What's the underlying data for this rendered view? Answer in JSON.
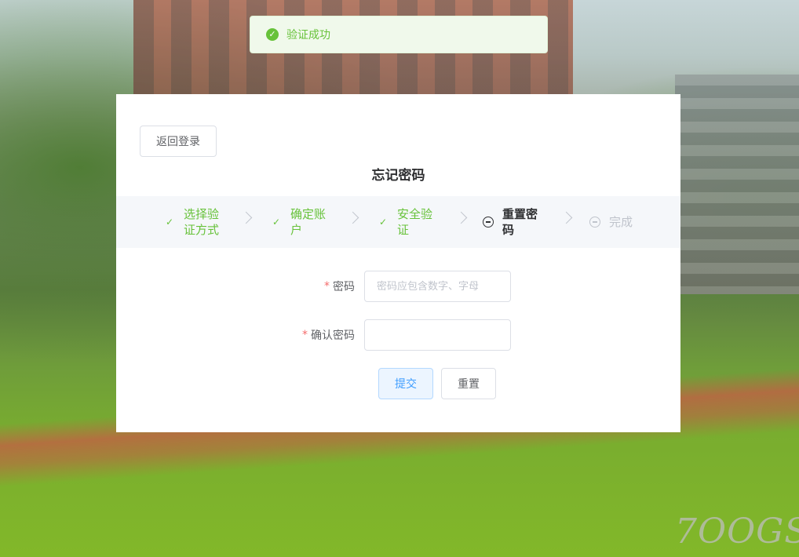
{
  "toast": {
    "message": "验证成功",
    "color": "#67c23a"
  },
  "card": {
    "back_button": "返回登录",
    "title": "忘记密码"
  },
  "steps": [
    {
      "label_line1": "选择验",
      "label_line2": "证方式",
      "status": "done"
    },
    {
      "label_line1": "确定账",
      "label_line2": "户",
      "status": "done"
    },
    {
      "label_line1": "安全验",
      "label_line2": "证",
      "status": "done"
    },
    {
      "label_line1": "重置密",
      "label_line2": "码",
      "status": "process"
    },
    {
      "label_line1": "完成",
      "label_line2": "",
      "status": "wait"
    }
  ],
  "form": {
    "password_label": "密码",
    "password_placeholder": "密码应包含数字、字母",
    "password_value": "",
    "confirm_label": "确认密码",
    "confirm_value": "",
    "required_mark": "*",
    "submit_label": "提交",
    "reset_label": "重置"
  },
  "watermark": "7OOGS",
  "colors": {
    "success": "#67c23a",
    "primary": "#409eff",
    "danger": "#f56c6c"
  }
}
